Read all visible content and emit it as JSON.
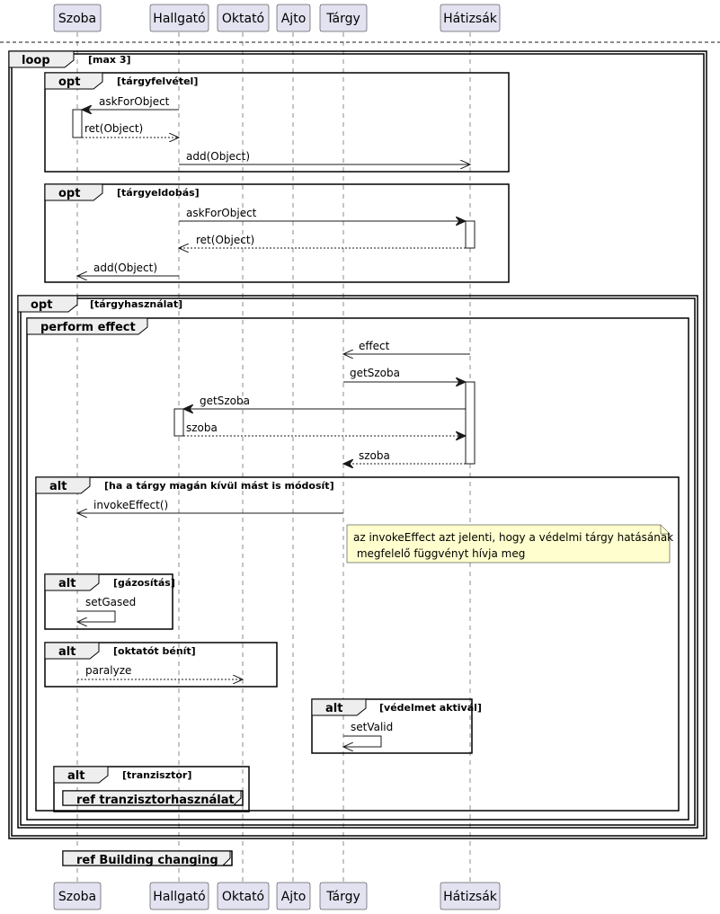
{
  "participants": [
    "Szoba",
    "Hallgató",
    "Oktató",
    "Ajto",
    "Tárgy",
    "Hátizsák"
  ],
  "frames": [
    {
      "kw": "loop",
      "cond": "[max 3]"
    },
    {
      "kw": "opt",
      "cond": "[tárgyfelvétel]"
    },
    {
      "kw": "opt",
      "cond": "[tárgyeldobás]"
    },
    {
      "kw": "opt",
      "cond": "[tárgyhasználat]"
    },
    {
      "kw": "perform effect",
      "cond": ""
    },
    {
      "kw": "alt",
      "cond": "[ha a tárgy magán kívül mást is módosít]"
    },
    {
      "kw": "alt",
      "cond": "[gázosítás]"
    },
    {
      "kw": "alt",
      "cond": "[oktatót bénít]"
    },
    {
      "kw": "alt",
      "cond": "[védelmet aktivál]"
    },
    {
      "kw": "alt",
      "cond": "[tranzisztor]"
    }
  ],
  "refs": [
    "ref tranzisztorhasználat",
    "ref Building changing"
  ],
  "messages": [
    {
      "from": "Hallgató",
      "to": "Szoba",
      "label": "askForObject",
      "style": "sync"
    },
    {
      "from": "Szoba",
      "to": "Hallgató",
      "label": "ret(Object)",
      "style": "return"
    },
    {
      "from": "Hallgató",
      "to": "Hátizsák",
      "label": "add(Object)",
      "style": "async"
    },
    {
      "from": "Hallgató",
      "to": "Hátizsák",
      "label": "askForObject",
      "style": "sync"
    },
    {
      "from": "Hátizsák",
      "to": "Hallgató",
      "label": "ret(Object)",
      "style": "return"
    },
    {
      "from": "Hallgató",
      "to": "Szoba",
      "label": "add(Object)",
      "style": "async"
    },
    {
      "from": "Hátizsák",
      "to": "Tárgy",
      "label": "effect",
      "style": "async"
    },
    {
      "from": "Tárgy",
      "to": "Hátizsák",
      "label": "getSzoba",
      "style": "sync"
    },
    {
      "from": "Hátizsák",
      "to": "Hallgató",
      "label": "getSzoba",
      "style": "sync"
    },
    {
      "from": "Hallgató",
      "to": "Hátizsák",
      "label": "szoba",
      "style": "return"
    },
    {
      "from": "Hátizsák",
      "to": "Tárgy",
      "label": "szoba",
      "style": "return"
    },
    {
      "from": "Tárgy",
      "to": "Szoba",
      "label": "invokeEffect()",
      "style": "async"
    },
    {
      "from": "Szoba",
      "to": "Szoba",
      "label": "setGased",
      "style": "self"
    },
    {
      "from": "Szoba",
      "to": "Oktató",
      "label": "paralyze",
      "style": "return"
    },
    {
      "from": "Tárgy",
      "to": "Tárgy",
      "label": "setValid",
      "style": "self"
    }
  ],
  "note": {
    "line1": "az invokeEffect azt jelenti, hogy a védelmi tárgy hatásának",
    "line2": " megfelelő függvényt hívja meg"
  }
}
